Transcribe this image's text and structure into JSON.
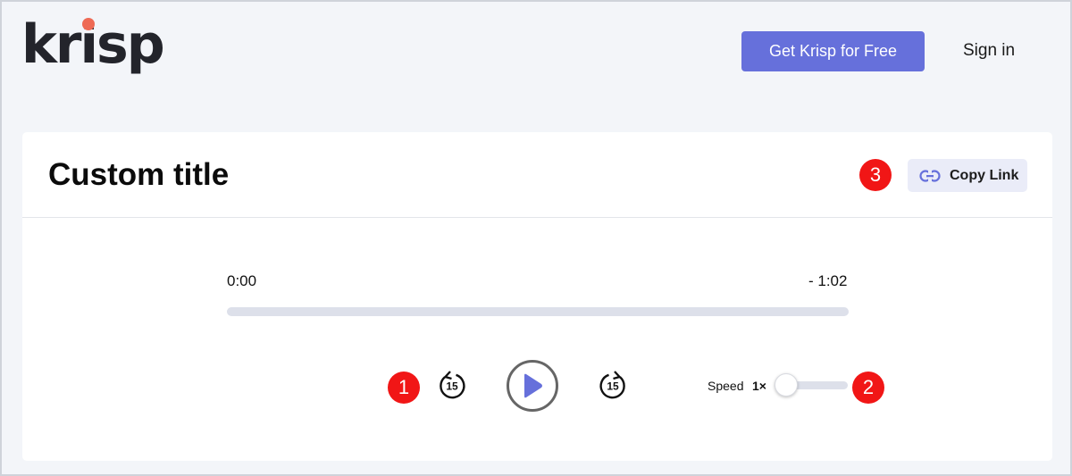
{
  "header": {
    "logo_text": "krisp",
    "cta_label": "Get Krisp for Free",
    "sign_in_label": "Sign in"
  },
  "card": {
    "title": "Custom title",
    "copy_link_label": "Copy Link"
  },
  "player": {
    "current_time": "0:00",
    "remaining_time": "- 1:02",
    "progress": 0,
    "skip_back_seconds": "15",
    "skip_forward_seconds": "15",
    "speed_label": "Speed",
    "speed_value": "1×"
  },
  "annotations": {
    "badge_1": "1",
    "badge_2": "2",
    "badge_3": "3"
  },
  "colors": {
    "accent": "#6670db",
    "logo_dot": "#ee6a55",
    "badge": "#f11616",
    "background": "#f3f5f9"
  },
  "icons": {
    "rewind": "rewind-15-icon",
    "forward": "forward-15-icon",
    "play": "play-icon",
    "link": "link-icon"
  }
}
